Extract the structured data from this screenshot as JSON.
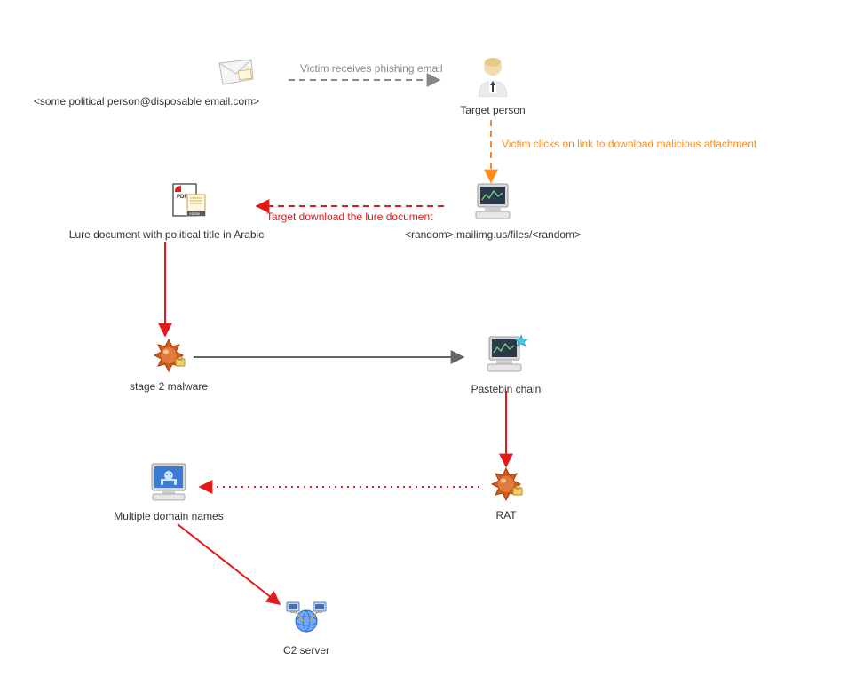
{
  "nodes": {
    "email": {
      "label": "<some political person@disposable email.com>"
    },
    "target": {
      "label": "Target person"
    },
    "server1": {
      "label": "<random>.mailimg.us/files/<random>"
    },
    "document": {
      "label": "Lure document with political title in Arabic"
    },
    "malware": {
      "label": "stage 2 malware"
    },
    "pastebin": {
      "label": "Pastebin chain"
    },
    "rat": {
      "label": "RAT"
    },
    "domains": {
      "label": "Multiple domain names"
    },
    "c2": {
      "label": "C2 server"
    }
  },
  "edges": {
    "phishing": {
      "label": "Victim receives phishing email"
    },
    "click": {
      "label": "Victim clicks on link to download malicious attachment"
    },
    "download": {
      "label": "Target download the lure document"
    }
  },
  "icons": {
    "email": "email-icon",
    "person": "person-icon",
    "server": "server-icon",
    "pdf": "pdf-icon",
    "bomb": "bomb-icon",
    "screen_skull": "infected-screen-icon",
    "network": "network-icon"
  }
}
